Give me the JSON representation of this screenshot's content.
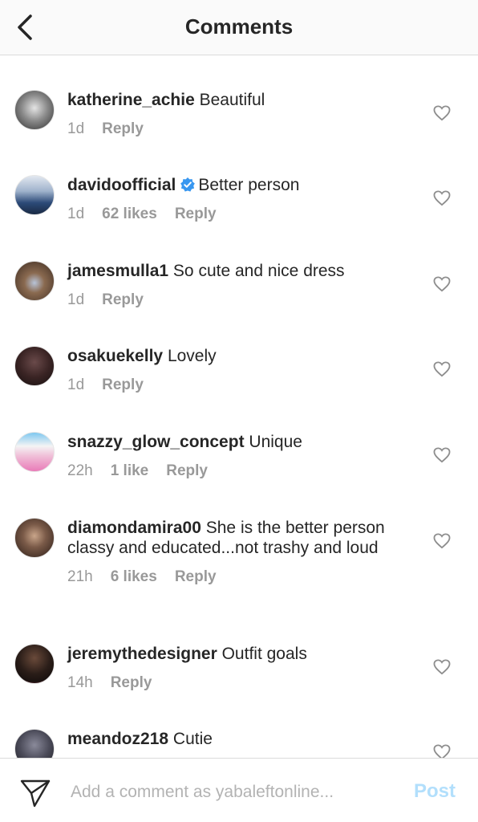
{
  "header": {
    "title": "Comments"
  },
  "comments": [
    {
      "username": "katherine_achie",
      "text": "Beautiful",
      "time": "1d",
      "likes": "",
      "reply": "Reply",
      "verified": false,
      "avatar_colors": [
        "#d9d9d9",
        "#555555"
      ]
    },
    {
      "username": "davidoofficial",
      "text": "Better person",
      "time": "1d",
      "likes": "62 likes",
      "reply": "Reply",
      "verified": true,
      "avatar_colors": [
        "#c7d2e0",
        "#2c4a78"
      ]
    },
    {
      "username": "jamesmulla1",
      "text": "So cute and nice dress",
      "time": "1d",
      "likes": "",
      "reply": "Reply",
      "verified": false,
      "avatar_colors": [
        "#9a7050",
        "#3b2a20"
      ]
    },
    {
      "username": "osakuekelly",
      "text": "Lovely",
      "time": "1d",
      "likes": "",
      "reply": "Reply",
      "verified": false,
      "avatar_colors": [
        "#5a3a3a",
        "#1e1414"
      ]
    },
    {
      "username": "snazzy_glow_concept",
      "text": "Unique",
      "time": "22h",
      "likes": "1 like",
      "reply": "Reply",
      "verified": false,
      "avatar_colors": [
        "#7ec8f0",
        "#e97bb8"
      ]
    },
    {
      "username": "diamondamira00",
      "text": "She is the better person classy and educated...not trashy and loud",
      "time": "21h",
      "likes": "6 likes",
      "reply": "Reply",
      "verified": false,
      "avatar_colors": [
        "#c9a58a",
        "#2b1d17"
      ]
    },
    {
      "username": "jeremythedesigner",
      "text": "Outfit goals",
      "time": "14h",
      "likes": "",
      "reply": "Reply",
      "verified": false,
      "avatar_colors": [
        "#3a2a22",
        "#e23b5a"
      ]
    },
    {
      "username": "meandoz218",
      "text": "Cutie",
      "time": "",
      "likes": "",
      "reply": "",
      "verified": false,
      "avatar_colors": [
        "#5a5a6a",
        "#1c1c22"
      ]
    }
  ],
  "composer": {
    "placeholder": "Add a comment as yabaleftonline...",
    "post_label": "Post"
  }
}
